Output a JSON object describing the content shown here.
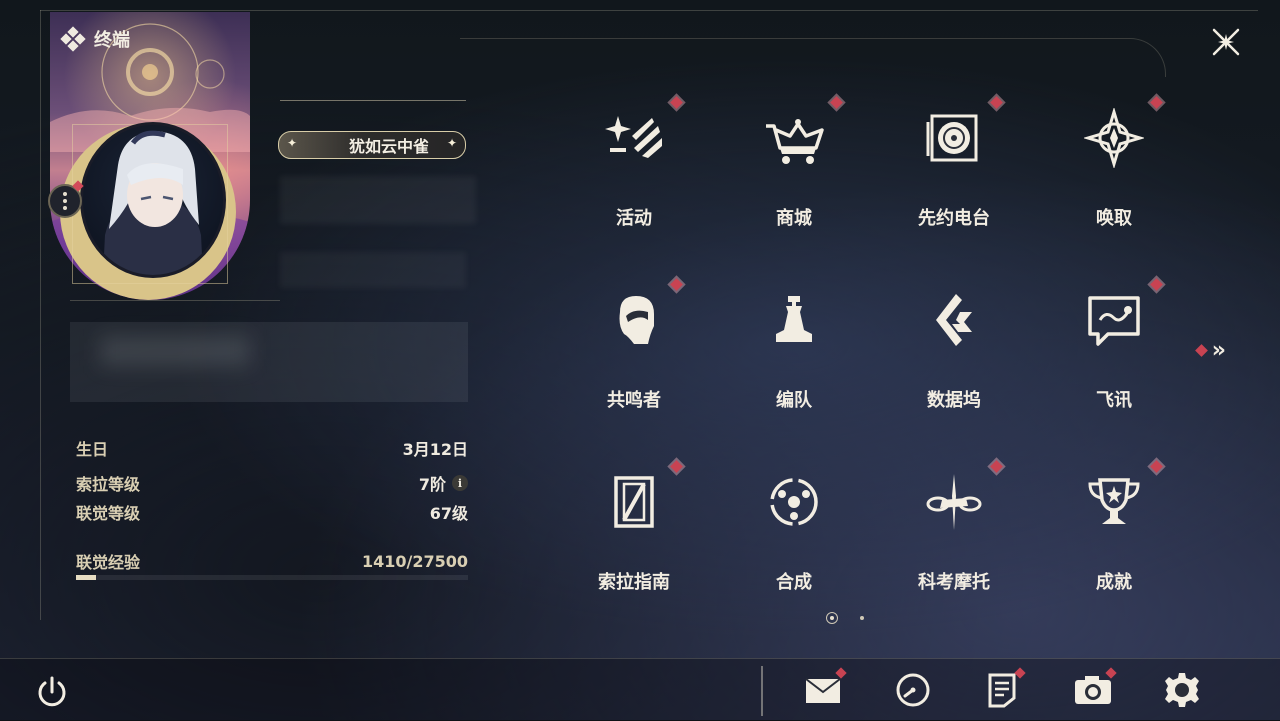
{
  "header": {
    "title": "终端",
    "close_icon": "close-x-icon"
  },
  "profile": {
    "title_badge": "犹如云中雀",
    "stats": [
      {
        "key": "生日",
        "value": "3月12日"
      },
      {
        "key": "索拉等级",
        "value": "7阶"
      },
      {
        "key": "联觉等级",
        "value": "67级"
      },
      {
        "key": "联觉经验",
        "value": "1410/27500"
      }
    ],
    "exp_progress": 0.0513
  },
  "grid": {
    "items": [
      {
        "label": "活动",
        "icon": "activity-sparkle-icon",
        "badge": true
      },
      {
        "label": "商城",
        "icon": "shop-cart-icon",
        "badge": true
      },
      {
        "label": "先约电台",
        "icon": "radio-record-icon",
        "badge": true
      },
      {
        "label": "唤取",
        "icon": "summon-compass-icon",
        "badge": true
      },
      {
        "label": "共鸣者",
        "icon": "resonator-head-icon",
        "badge": true
      },
      {
        "label": "编队",
        "icon": "team-chess-icon",
        "badge": false
      },
      {
        "label": "数据坞",
        "icon": "data-dock-icon",
        "badge": false
      },
      {
        "label": "飞讯",
        "icon": "chat-message-icon",
        "badge": true
      },
      {
        "label": "索拉指南",
        "icon": "guide-book-icon",
        "badge": true
      },
      {
        "label": "合成",
        "icon": "synthesis-icon",
        "badge": false
      },
      {
        "label": "科考摩托",
        "icon": "motorbike-icon",
        "badge": true
      },
      {
        "label": "成就",
        "icon": "trophy-icon",
        "badge": true
      }
    ],
    "next_page_icon": "double-chevron-right-icon"
  },
  "pager": {
    "current": 1,
    "total": 2
  },
  "bottom_bar": {
    "power_icon": "power-icon",
    "buttons": [
      {
        "name": "mail",
        "icon": "mail-icon",
        "badge": true
      },
      {
        "name": "clock",
        "icon": "clock-icon",
        "badge": false
      },
      {
        "name": "notes",
        "icon": "notes-icon",
        "badge": true
      },
      {
        "name": "camera",
        "icon": "camera-icon",
        "badge": true
      },
      {
        "name": "settings",
        "icon": "gear-icon",
        "badge": false
      }
    ]
  },
  "colors": {
    "accent_badge": "#c84352",
    "text": "#f2ede2",
    "gold": "#d9c489"
  }
}
